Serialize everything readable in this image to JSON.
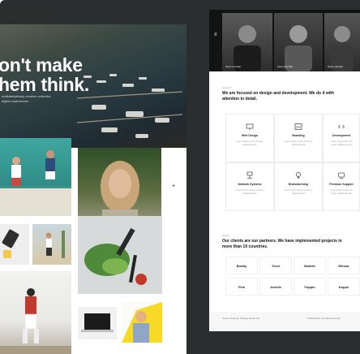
{
  "left_page": {
    "hero": {
      "title": "on't make\nhem think.",
      "subtitle": "multidisciplinary creative collective digital experiences"
    },
    "plus_icon": "+",
    "images": [
      {
        "name": "tennis-players-photo"
      },
      {
        "name": "woman-portrait-photo"
      },
      {
        "name": "items-flatlay-photo"
      },
      {
        "name": "runner-photo"
      },
      {
        "name": "food-knife-photo"
      },
      {
        "name": "baseball-player-photo"
      },
      {
        "name": "laptop-photo"
      },
      {
        "name": "yellow-portrait-photo"
      }
    ]
  },
  "right_page": {
    "nav_mark": "≡",
    "team": [
      {
        "name": "Team member"
      },
      {
        "name": "Team member"
      },
      {
        "name": "Team member"
      }
    ],
    "services_eyebrow": "services",
    "focus_title": "We are focused on design and development. We do it with attention to detail.",
    "services": [
      {
        "title": "Web Design",
        "desc": "Lorem ipsum dolor sit amet, adipiscing elit",
        "icon": "monitor-icon"
      },
      {
        "title": "Branding",
        "desc": "Lorem ipsum dolor sit amet, adipiscing elit",
        "icon": "image-icon"
      },
      {
        "title": "Development",
        "desc": "Lorem ipsum dolor sit amet, adipiscing elit",
        "icon": "code-icon"
      },
      {
        "title": "Network Systems",
        "desc": "Lorem ipsum dolor sit amet, adipiscing elit",
        "icon": "network-icon"
      },
      {
        "title": "Brainstorming",
        "desc": "Lorem ipsum dolor sit amet, adipiscing elit",
        "icon": "bulb-icon"
      },
      {
        "title": "Premium Support",
        "desc": "Lorem ipsum dolor sit amet, adipiscing elit",
        "icon": "support-icon"
      }
    ],
    "clients_eyebrow": "clients",
    "clients_title": "Our clients are our partners. We have implemented projects in more than 10 countries.",
    "logos": [
      "Buddy",
      "Tessi",
      "Mobilix",
      "Elinear",
      "Flek",
      "Arteefs",
      "Fuppin",
      "Koppe"
    ],
    "footer": {
      "col1": "Vortex 3 Avenue, Chicago phone info",
      "col2": "© 2024 Vortex, All rights reserved"
    }
  },
  "colors": {
    "frame_dark": "#2a2e2e",
    "right_top_dark": "#121414",
    "accent_yellow": "#f5d400"
  }
}
